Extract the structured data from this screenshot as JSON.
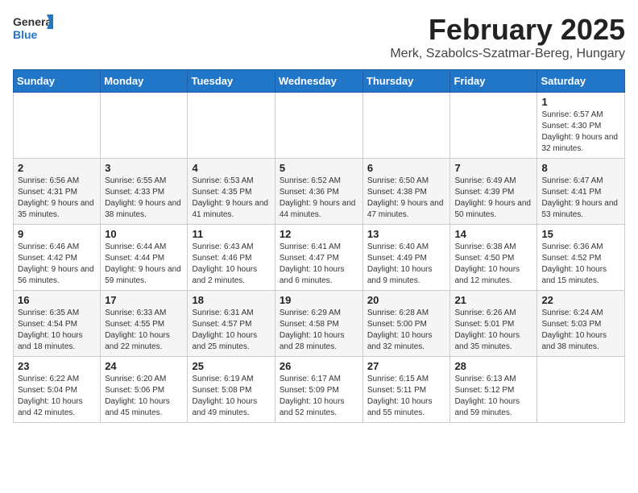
{
  "logo": {
    "general": "General",
    "blue": "Blue"
  },
  "title": "February 2025",
  "subtitle": "Merk, Szabolcs-Szatmar-Bereg, Hungary",
  "weekdays": [
    "Sunday",
    "Monday",
    "Tuesday",
    "Wednesday",
    "Thursday",
    "Friday",
    "Saturday"
  ],
  "weeks": [
    [
      {
        "day": "",
        "info": ""
      },
      {
        "day": "",
        "info": ""
      },
      {
        "day": "",
        "info": ""
      },
      {
        "day": "",
        "info": ""
      },
      {
        "day": "",
        "info": ""
      },
      {
        "day": "",
        "info": ""
      },
      {
        "day": "1",
        "info": "Sunrise: 6:57 AM\nSunset: 4:30 PM\nDaylight: 9 hours and 32 minutes."
      }
    ],
    [
      {
        "day": "2",
        "info": "Sunrise: 6:56 AM\nSunset: 4:31 PM\nDaylight: 9 hours and 35 minutes."
      },
      {
        "day": "3",
        "info": "Sunrise: 6:55 AM\nSunset: 4:33 PM\nDaylight: 9 hours and 38 minutes."
      },
      {
        "day": "4",
        "info": "Sunrise: 6:53 AM\nSunset: 4:35 PM\nDaylight: 9 hours and 41 minutes."
      },
      {
        "day": "5",
        "info": "Sunrise: 6:52 AM\nSunset: 4:36 PM\nDaylight: 9 hours and 44 minutes."
      },
      {
        "day": "6",
        "info": "Sunrise: 6:50 AM\nSunset: 4:38 PM\nDaylight: 9 hours and 47 minutes."
      },
      {
        "day": "7",
        "info": "Sunrise: 6:49 AM\nSunset: 4:39 PM\nDaylight: 9 hours and 50 minutes."
      },
      {
        "day": "8",
        "info": "Sunrise: 6:47 AM\nSunset: 4:41 PM\nDaylight: 9 hours and 53 minutes."
      }
    ],
    [
      {
        "day": "9",
        "info": "Sunrise: 6:46 AM\nSunset: 4:42 PM\nDaylight: 9 hours and 56 minutes."
      },
      {
        "day": "10",
        "info": "Sunrise: 6:44 AM\nSunset: 4:44 PM\nDaylight: 9 hours and 59 minutes."
      },
      {
        "day": "11",
        "info": "Sunrise: 6:43 AM\nSunset: 4:46 PM\nDaylight: 10 hours and 2 minutes."
      },
      {
        "day": "12",
        "info": "Sunrise: 6:41 AM\nSunset: 4:47 PM\nDaylight: 10 hours and 6 minutes."
      },
      {
        "day": "13",
        "info": "Sunrise: 6:40 AM\nSunset: 4:49 PM\nDaylight: 10 hours and 9 minutes."
      },
      {
        "day": "14",
        "info": "Sunrise: 6:38 AM\nSunset: 4:50 PM\nDaylight: 10 hours and 12 minutes."
      },
      {
        "day": "15",
        "info": "Sunrise: 6:36 AM\nSunset: 4:52 PM\nDaylight: 10 hours and 15 minutes."
      }
    ],
    [
      {
        "day": "16",
        "info": "Sunrise: 6:35 AM\nSunset: 4:54 PM\nDaylight: 10 hours and 18 minutes."
      },
      {
        "day": "17",
        "info": "Sunrise: 6:33 AM\nSunset: 4:55 PM\nDaylight: 10 hours and 22 minutes."
      },
      {
        "day": "18",
        "info": "Sunrise: 6:31 AM\nSunset: 4:57 PM\nDaylight: 10 hours and 25 minutes."
      },
      {
        "day": "19",
        "info": "Sunrise: 6:29 AM\nSunset: 4:58 PM\nDaylight: 10 hours and 28 minutes."
      },
      {
        "day": "20",
        "info": "Sunrise: 6:28 AM\nSunset: 5:00 PM\nDaylight: 10 hours and 32 minutes."
      },
      {
        "day": "21",
        "info": "Sunrise: 6:26 AM\nSunset: 5:01 PM\nDaylight: 10 hours and 35 minutes."
      },
      {
        "day": "22",
        "info": "Sunrise: 6:24 AM\nSunset: 5:03 PM\nDaylight: 10 hours and 38 minutes."
      }
    ],
    [
      {
        "day": "23",
        "info": "Sunrise: 6:22 AM\nSunset: 5:04 PM\nDaylight: 10 hours and 42 minutes."
      },
      {
        "day": "24",
        "info": "Sunrise: 6:20 AM\nSunset: 5:06 PM\nDaylight: 10 hours and 45 minutes."
      },
      {
        "day": "25",
        "info": "Sunrise: 6:19 AM\nSunset: 5:08 PM\nDaylight: 10 hours and 49 minutes."
      },
      {
        "day": "26",
        "info": "Sunrise: 6:17 AM\nSunset: 5:09 PM\nDaylight: 10 hours and 52 minutes."
      },
      {
        "day": "27",
        "info": "Sunrise: 6:15 AM\nSunset: 5:11 PM\nDaylight: 10 hours and 55 minutes."
      },
      {
        "day": "28",
        "info": "Sunrise: 6:13 AM\nSunset: 5:12 PM\nDaylight: 10 hours and 59 minutes."
      },
      {
        "day": "",
        "info": ""
      }
    ]
  ]
}
